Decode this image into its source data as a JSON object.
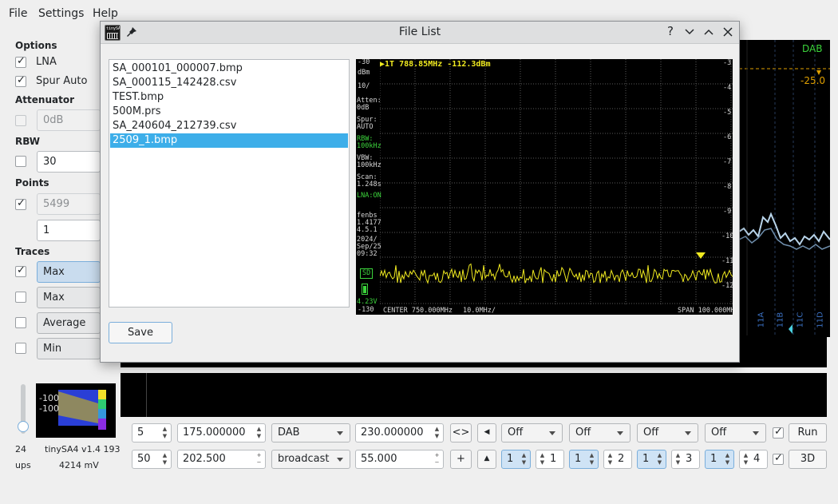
{
  "menu": {
    "file": "File",
    "settings": "Settings",
    "help": "Help"
  },
  "options": {
    "title": "Options",
    "lna_label": "LNA",
    "spur_label": "Spur Auto",
    "attenuator_title": "Attenuator",
    "attenuator_value": "0dB",
    "rbw_title": "RBW",
    "rbw_value": "30",
    "points_title": "Points",
    "points_value": "5499",
    "points_value2": "1",
    "traces_title": "Traces",
    "trace1": "Max",
    "trace2": "Max",
    "trace3": "Average",
    "trace4": "Min"
  },
  "status": {
    "slider_value": "24",
    "ups_label": "ups",
    "device": "tinySA4 v1.4 193",
    "voltage": "4214 mV",
    "thumb_level1": "-100",
    "thumb_level2": "-100"
  },
  "bg_plot": {
    "label": "DAB",
    "marker_value": "-25.0",
    "channels": [
      "11A",
      "11B",
      "11C",
      "11D"
    ]
  },
  "controls": {
    "row1": {
      "spin1": "5",
      "freq1": "175.000000",
      "preset": "DAB",
      "freq2": "230.000000",
      "swap": "<>",
      "off1": "Off",
      "off2": "Off",
      "off3": "Off",
      "off4": "Off",
      "run": "Run"
    },
    "row2": {
      "spin1": "50",
      "freq1": "202.500",
      "preset": "broadcast",
      "freq2": "55.000",
      "plus": "+",
      "m1": "1",
      "m1b": "1",
      "m2": "1",
      "m2b": "2",
      "m3": "1",
      "m3b": "3",
      "m4": "1",
      "m4b": "4",
      "view": "3D"
    }
  },
  "dialog": {
    "title": "File List",
    "files": [
      "SA_000101_000007.bmp",
      "SA_000115_142428.csv",
      "TEST.bmp",
      "500M.prs",
      "SA_240604_212739.csv",
      "2509_1.bmp"
    ],
    "selected_index": 5,
    "save": "Save",
    "help_btn": "?",
    "app_icon": "tinySA"
  },
  "screenshot": {
    "marker_readout": "▶1T  788.85MHz -112.3dBm",
    "ref_level": "-30",
    "unit": "dBm",
    "scale": "10/",
    "atten": "Atten:\n0dB",
    "spur": "Spur:\nAUTO",
    "rbw": "RBW:\n100kHz",
    "vbw": "VBW:\n100kHz",
    "scan": "Scan:\n1.248s",
    "lna": "LNA:ON",
    "info": "fenbs\n1.4177\n4.5.1",
    "date": "2024/\nSep/25\n09:32",
    "sd": "SD",
    "battery": "4.23V",
    "bottom_level": "-130",
    "center": "CENTER 750.000MHz",
    "div": "10.0MHz/",
    "span": "SPAN 100.000MHz",
    "right_ticks": [
      "-3",
      "-4",
      "-5",
      "-6",
      "-7",
      "-8",
      "-9",
      "-10",
      "-11",
      "-12"
    ],
    "marker_tag": "1"
  }
}
